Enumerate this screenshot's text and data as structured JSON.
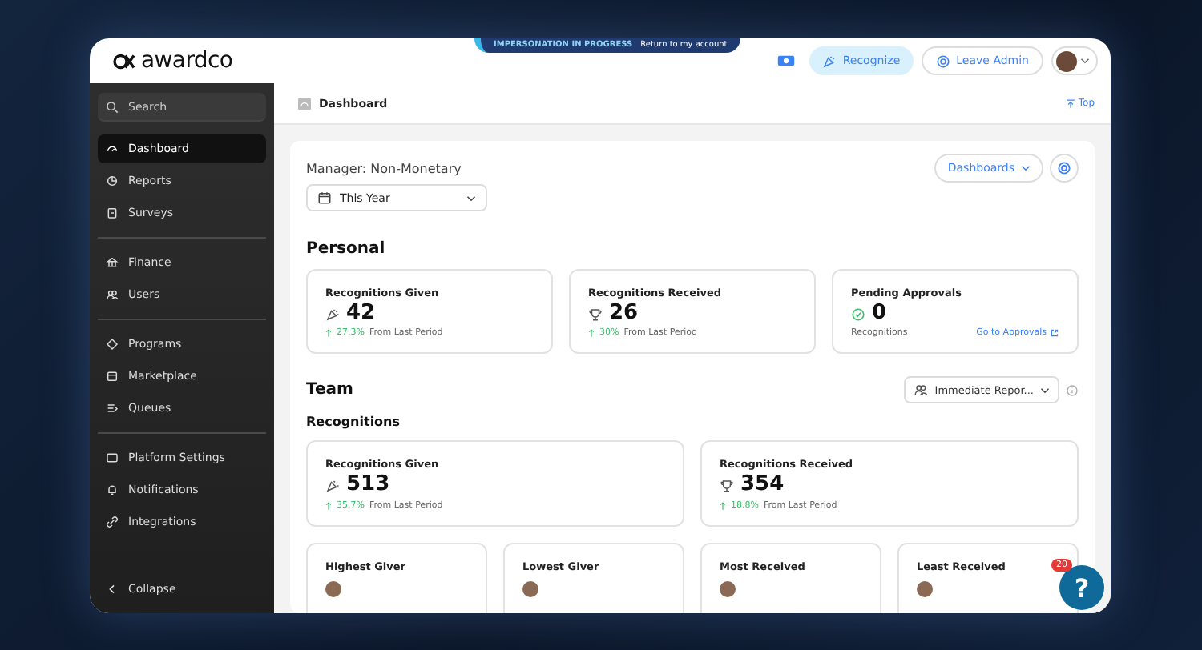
{
  "banner": {
    "label": "IMPERSONATION IN PROGRESS",
    "link": "Return to my account"
  },
  "header": {
    "logo": "awardco",
    "recognize": "Recognize",
    "leave_admin": "Leave Admin"
  },
  "sidebar": {
    "search": "Search",
    "groups": [
      [
        {
          "label": "Dashboard",
          "selected": true
        },
        {
          "label": "Reports",
          "selected": false
        },
        {
          "label": "Surveys",
          "selected": false
        }
      ],
      [
        {
          "label": "Finance",
          "selected": false
        },
        {
          "label": "Users",
          "selected": false
        }
      ],
      [
        {
          "label": "Programs",
          "selected": false
        },
        {
          "label": "Marketplace",
          "selected": false
        },
        {
          "label": "Queues",
          "selected": false
        }
      ],
      [
        {
          "label": "Platform Settings",
          "selected": false
        },
        {
          "label": "Notifications",
          "selected": false
        },
        {
          "label": "Integrations",
          "selected": false
        }
      ]
    ],
    "collapse": "Collapse"
  },
  "breadcrumb": {
    "title": "Dashboard",
    "top_link": "Top"
  },
  "dashboard": {
    "title": "Manager: Non-Monetary",
    "date_range": "This Year",
    "dashboards_button": "Dashboards",
    "personal": {
      "heading": "Personal",
      "cards": [
        {
          "kind": "trend",
          "title": "Recognitions Given",
          "value": "42",
          "change": "27.3%",
          "change_label": "From Last Period"
        },
        {
          "kind": "trend",
          "title": "Recognitions Received",
          "value": "26",
          "change": "30%",
          "change_label": "From Last Period"
        },
        {
          "kind": "approvals",
          "title": "Pending Approvals",
          "value": "0",
          "caption": "Recognitions",
          "link": "Go to Approvals"
        }
      ]
    },
    "team": {
      "heading": "Team",
      "scope": "Immediate Repor...",
      "subheading": "Recognitions",
      "cards": [
        {
          "kind": "trend",
          "title": "Recognitions Given",
          "value": "513",
          "change": "35.7%",
          "change_label": "From Last Period"
        },
        {
          "kind": "trend",
          "title": "Recognitions Received",
          "value": "354",
          "change": "18.8%",
          "change_label": "From Last Period"
        }
      ],
      "people": [
        {
          "title": "Highest Giver"
        },
        {
          "title": "Lowest Giver"
        },
        {
          "title": "Most Received"
        },
        {
          "title": "Least Received"
        }
      ]
    }
  },
  "help": {
    "badge": "20",
    "label": "?"
  }
}
